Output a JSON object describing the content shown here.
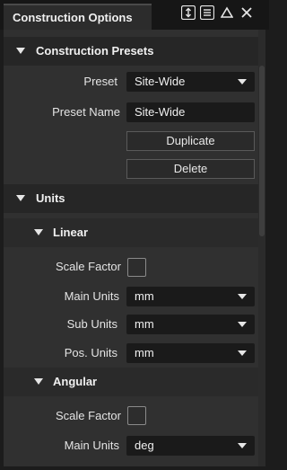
{
  "window": {
    "tab_title": "Construction Options",
    "icons": [
      "resize-vertical-icon",
      "menu-icon",
      "collapse-icon",
      "close-icon"
    ]
  },
  "sections": {
    "presets": {
      "title": "Construction Presets",
      "preset_label": "Preset",
      "preset_value": "Site-Wide",
      "preset_name_label": "Preset Name",
      "preset_name_value": "Site-Wide",
      "duplicate_label": "Duplicate",
      "delete_label": "Delete"
    },
    "units": {
      "title": "Units",
      "linear": {
        "title": "Linear",
        "scale_factor_label": "Scale Factor",
        "scale_factor_checked": false,
        "main_units_label": "Main Units",
        "main_units_value": "mm",
        "sub_units_label": "Sub Units",
        "sub_units_value": "mm",
        "pos_units_label": "Pos. Units",
        "pos_units_value": "mm"
      },
      "angular": {
        "title": "Angular",
        "scale_factor_label": "Scale Factor",
        "scale_factor_checked": false,
        "main_units_label": "Main Units",
        "main_units_value": "deg"
      }
    }
  },
  "colors": {
    "panel_bg": "#303030",
    "section_bg": "#262626",
    "field_bg": "#1a1a1a",
    "text": "#e4e4e4"
  }
}
